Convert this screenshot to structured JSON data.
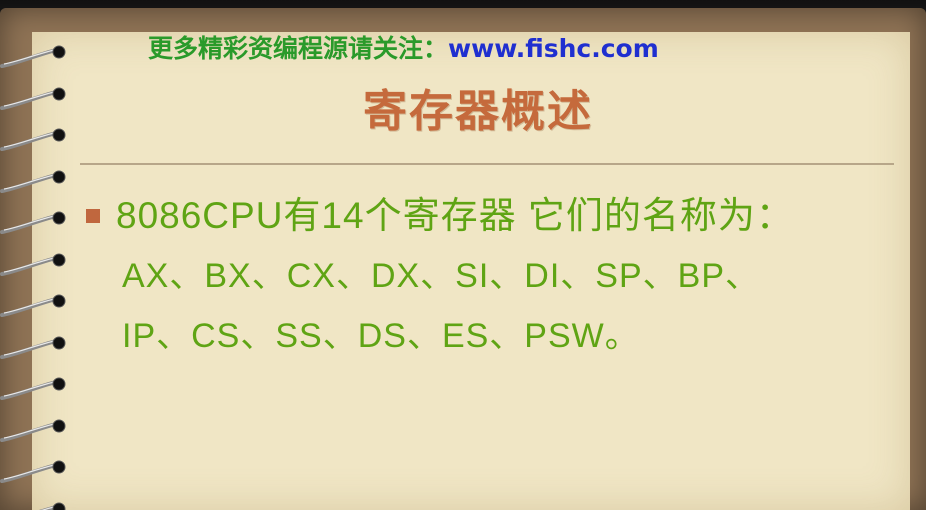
{
  "header": {
    "promo_text": "更多精彩资编程源请关注：",
    "url": "www.fishc.com"
  },
  "slide": {
    "title": "寄存器概述",
    "bullet_line": "8086CPU有14个寄存器 它们的名称为：",
    "register_line_1": "AX、BX、CX、DX、SI、DI、SP、BP、",
    "register_line_2": "IP、CS、SS、DS、ES、PSW。"
  },
  "colors": {
    "promo_green": "#2a9a2a",
    "url_blue": "#1f2fd0",
    "title_orange": "#c56a3c",
    "body_green": "#5fa414",
    "paper": "#f0e6c5",
    "frame_brown": "#8f7355"
  },
  "icons": {
    "binding": "spiral-binding-icon",
    "bullet": "square-bullet-icon"
  }
}
